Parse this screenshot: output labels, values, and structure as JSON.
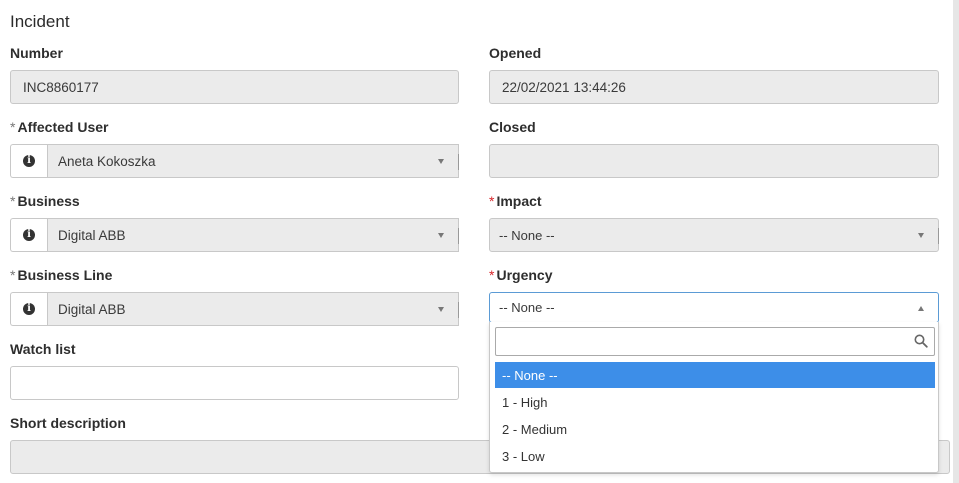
{
  "form": {
    "title": "Incident",
    "number": {
      "label": "Number",
      "value": "INC8860177"
    },
    "opened": {
      "label": "Opened",
      "value": "22/02/2021 13:44:26"
    },
    "affected_user": {
      "required_mark": "*",
      "label": "Affected User",
      "value": "Aneta Kokoszka"
    },
    "closed": {
      "label": "Closed",
      "value": ""
    },
    "business": {
      "required_mark": "*",
      "label": "Business",
      "value": "Digital ABB"
    },
    "impact": {
      "required_mark": "*",
      "label": "Impact",
      "value": "-- None --"
    },
    "business_line": {
      "required_mark": "*",
      "label": "Business Line",
      "value": "Digital ABB"
    },
    "urgency": {
      "required_mark": "*",
      "label": "Urgency",
      "value": "-- None --",
      "search_value": "",
      "options": [
        "-- None --",
        "1 - High",
        "2 - Medium",
        "3 - Low"
      ]
    },
    "watch_list": {
      "label": "Watch list",
      "value": ""
    },
    "short_description": {
      "label": "Short description",
      "value": ""
    }
  },
  "icons": {
    "info": "info-icon",
    "dropdown": "chevron-down-icon",
    "search": "search-icon"
  },
  "colors": {
    "required_red": "#d7262a",
    "highlight_blue": "#3d8ee8",
    "focus_border": "#5b9bd5"
  }
}
